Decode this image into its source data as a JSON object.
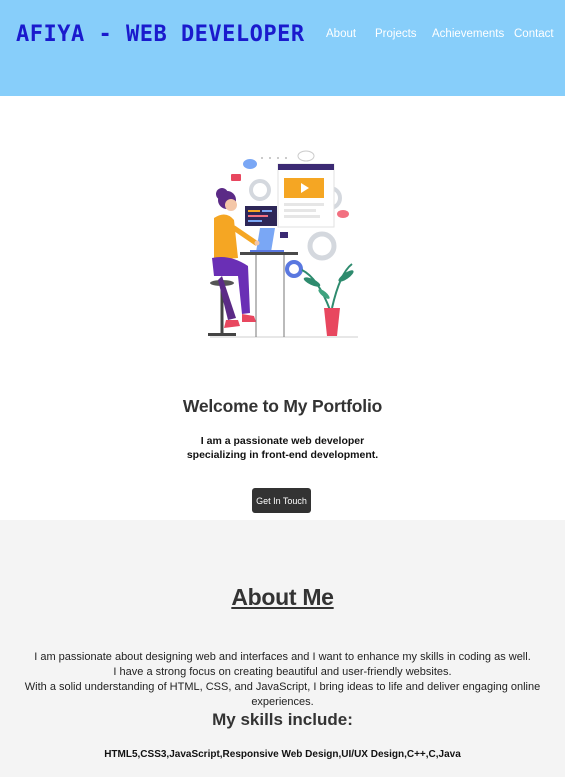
{
  "header": {
    "logo": "AFIYA - WEB DEVELOPER",
    "nav": [
      "About",
      "Projects",
      "Achievements",
      "Contact"
    ]
  },
  "hero": {
    "title": "Welcome to My Portfolio",
    "tagline_line1": "I am a passionate web developer",
    "tagline_line2": "specializing in front-end development.",
    "button": "Get In Touch"
  },
  "about": {
    "title": "About Me",
    "line1": "I am passionate about designing web and interfaces and I want to enhance my skills in coding as well.",
    "line2": "I have a strong focus on creating beautiful and user-friendly websites.",
    "line3": "With a solid understanding of HTML, CSS, and JavaScript, I bring ideas to life and deliver engaging online experiences.",
    "skills_title": "My skills include:",
    "skills": "HTML5,CSS3,JavaScript,Responsive Web Design,UI/UX Design,C++,C,Java"
  },
  "colors": {
    "header_bg": "#87cefa",
    "logo": "#1a1acd",
    "button_bg": "#333333",
    "about_bg": "#f4f4f4"
  }
}
